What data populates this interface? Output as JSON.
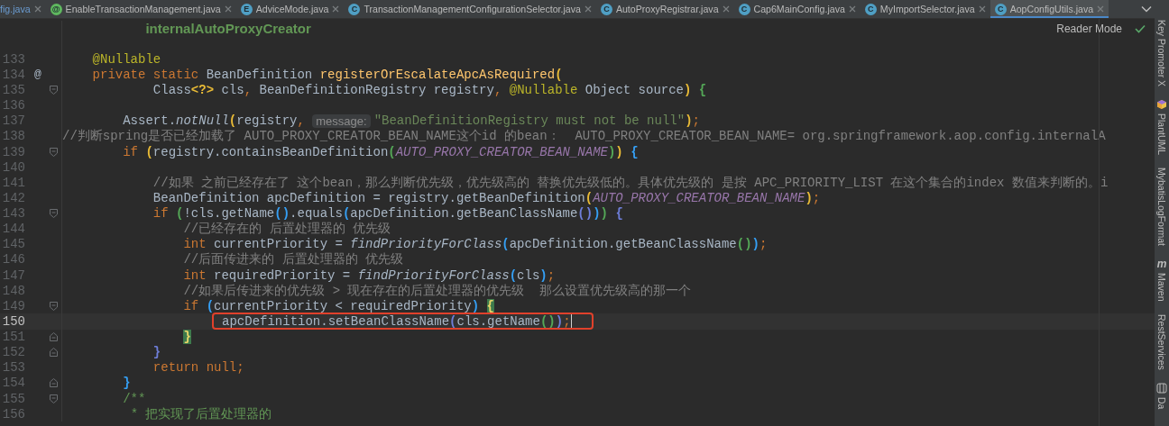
{
  "tabs": [
    {
      "label": "fig.java",
      "selected": false
    },
    {
      "label": "EnableTransactionManagement.java",
      "kind": "annotation",
      "icon_letter": "@",
      "selected": false
    },
    {
      "label": "AdviceMode.java",
      "kind": "enum",
      "icon_letter": "E",
      "selected": false
    },
    {
      "label": "TransactionManagementConfigurationSelector.java",
      "kind": "class",
      "icon_letter": "C",
      "selected": false
    },
    {
      "label": "AutoProxyRegistrar.java",
      "kind": "class",
      "icon_letter": "C",
      "selected": false
    },
    {
      "label": "Cap6MainConfig.java",
      "kind": "class",
      "icon_letter": "C",
      "selected": false
    },
    {
      "label": "MyImportSelector.java",
      "kind": "class",
      "icon_letter": "C",
      "selected": false
    },
    {
      "label": "AopConfigUtils.java",
      "kind": "class",
      "icon_letter": "C",
      "selected": true
    }
  ],
  "reader_mode": {
    "label": "Reader Mode"
  },
  "lines": [
    {
      "current": false,
      "tokens": [
        {
          "kind": "doc-bold",
          "text": "           internalAutoProxyCreator"
        }
      ]
    },
    {
      "current": false
    },
    {
      "number": "133",
      "current": false,
      "tokens": [
        {
          "kind": "annotation",
          "text": "    @Nullable"
        }
      ]
    },
    {
      "number": "134",
      "gutter": "@",
      "current": false,
      "tokens": [
        {
          "kind": "keyword",
          "text": "    private static "
        },
        {
          "kind": "plain",
          "text": "BeanDefinition "
        },
        {
          "kind": "decl",
          "text": "registerOrEscalateApcAsRequired"
        },
        {
          "kind": "bracket",
          "text": "(",
          "color": "#e8ba36"
        }
      ]
    },
    {
      "number": "135",
      "fold_open": true,
      "current": false,
      "tokens": [
        {
          "kind": "plain",
          "text": "            Class"
        },
        {
          "kind": "bracket",
          "text": "<?>",
          "color": "#e8ba36"
        },
        {
          "kind": "plain",
          "text": " cls"
        },
        {
          "kind": "keyword",
          "text": ", "
        },
        {
          "kind": "plain",
          "text": "BeanDefinitionRegistry registry"
        },
        {
          "kind": "keyword",
          "text": ", "
        },
        {
          "kind": "annotation",
          "text": "@Nullable"
        },
        {
          "kind": "plain",
          "text": " Object source"
        },
        {
          "kind": "bracket",
          "text": ") ",
          "color": "#e8ba36"
        },
        {
          "kind": "bracket",
          "text": "{",
          "color": "#54a857"
        }
      ]
    },
    {
      "number": "136",
      "current": false
    },
    {
      "number": "137",
      "current": false,
      "tokens": [
        {
          "kind": "plain",
          "text": "        Assert."
        },
        {
          "kind": "static-call",
          "text": "notNull"
        },
        {
          "kind": "bracket",
          "text": "(",
          "color": "#e8ba36"
        },
        {
          "kind": "plain",
          "text": "registry"
        },
        {
          "kind": "keyword",
          "text": ", "
        },
        {
          "kind": "hint",
          "text": "message:"
        },
        {
          "kind": "string",
          "text": "\"BeanDefinitionRegistry must not be null\""
        },
        {
          "kind": "bracket",
          "text": ")",
          "color": "#e8ba36"
        },
        {
          "kind": "keyword",
          "text": ";"
        }
      ]
    },
    {
      "number": "138",
      "current": false,
      "tokens": [
        {
          "kind": "comment",
          "text": "//判断spring是否已经加载了 AUTO_PROXY_CREATOR_BEAN_NAME这个id 的bean：  AUTO_PROXY_CREATOR_BEAN_NAME= org.springframework.aop.config.internalA"
        }
      ]
    },
    {
      "number": "139",
      "fold_open": true,
      "current": false,
      "tokens": [
        {
          "kind": "keyword",
          "text": "        if "
        },
        {
          "kind": "bracket",
          "text": "(",
          "color": "#e8ba36"
        },
        {
          "kind": "plain",
          "text": "registry.containsBeanDefinition"
        },
        {
          "kind": "bracket",
          "text": "(",
          "color": "#54a857"
        },
        {
          "kind": "constant",
          "text": "AUTO_PROXY_CREATOR_BEAN_NAME"
        },
        {
          "kind": "bracket",
          "text": ")",
          "color": "#54a857"
        },
        {
          "kind": "bracket",
          "text": ") ",
          "color": "#e8ba36"
        },
        {
          "kind": "bracket",
          "text": "{",
          "color": "#359ff4"
        }
      ]
    },
    {
      "number": "140",
      "current": false
    },
    {
      "number": "141",
      "current": false,
      "tokens": [
        {
          "kind": "comment",
          "text": "            //如果 之前已经存在了 这个bean，那么判断优先级，优先级高的 替换优先级低的。具体优先级的 是按 APC_PRIORITY_LIST 在这个集合的index 数值来判断的。i"
        }
      ]
    },
    {
      "number": "142",
      "current": false,
      "tokens": [
        {
          "kind": "plain",
          "text": "            BeanDefinition apcDefinition = registry.getBeanDefinition"
        },
        {
          "kind": "bracket",
          "text": "(",
          "color": "#e8ba36"
        },
        {
          "kind": "constant",
          "text": "AUTO_PROXY_CREATOR_BEAN_NAME"
        },
        {
          "kind": "bracket",
          "text": ")",
          "color": "#e8ba36"
        },
        {
          "kind": "keyword",
          "text": ";"
        }
      ]
    },
    {
      "number": "143",
      "fold_open": true,
      "current": false,
      "tokens": [
        {
          "kind": "keyword",
          "text": "            if "
        },
        {
          "kind": "bracket",
          "text": "(",
          "color": "#54a857"
        },
        {
          "kind": "plain",
          "text": "!cls.getName"
        },
        {
          "kind": "bracket",
          "text": "()",
          "color": "#359ff4"
        },
        {
          "kind": "plain",
          "text": ".equals"
        },
        {
          "kind": "bracket",
          "text": "(",
          "color": "#359ff4"
        },
        {
          "kind": "plain",
          "text": "apcDefinition.getBeanClassName"
        },
        {
          "kind": "bracket",
          "text": "()",
          "color": "#6e7ed9"
        },
        {
          "kind": "bracket",
          "text": ")",
          "color": "#359ff4"
        },
        {
          "kind": "bracket",
          "text": ") ",
          "color": "#54a857"
        },
        {
          "kind": "bracket",
          "text": "{",
          "color": "#6e7ed9"
        }
      ]
    },
    {
      "number": "144",
      "current": false,
      "tokens": [
        {
          "kind": "comment",
          "text": "                //已经存在的 后置处理器的 优先级"
        }
      ]
    },
    {
      "number": "145",
      "current": false,
      "tokens": [
        {
          "kind": "keyword",
          "text": "                int "
        },
        {
          "kind": "plain",
          "text": "currentPriority = "
        },
        {
          "kind": "static-call",
          "text": "findPriorityForClass"
        },
        {
          "kind": "bracket",
          "text": "(",
          "color": "#359ff4"
        },
        {
          "kind": "plain",
          "text": "apcDefinition.getBeanClassName"
        },
        {
          "kind": "bracket",
          "text": "()",
          "color": "#54a857"
        },
        {
          "kind": "bracket",
          "text": ")",
          "color": "#359ff4"
        },
        {
          "kind": "keyword",
          "text": ";"
        }
      ]
    },
    {
      "number": "146",
      "current": false,
      "tokens": [
        {
          "kind": "comment",
          "text": "                //后面传进来的 后置处理器的 优先级"
        }
      ]
    },
    {
      "number": "147",
      "current": false,
      "tokens": [
        {
          "kind": "keyword",
          "text": "                int "
        },
        {
          "kind": "plain",
          "text": "requiredPriority = "
        },
        {
          "kind": "static-call",
          "text": "findPriorityForClass"
        },
        {
          "kind": "bracket",
          "text": "(",
          "color": "#359ff4"
        },
        {
          "kind": "plain",
          "text": "cls"
        },
        {
          "kind": "bracket",
          "text": ")",
          "color": "#359ff4"
        },
        {
          "kind": "keyword",
          "text": ";"
        }
      ]
    },
    {
      "number": "148",
      "current": false,
      "tokens": [
        {
          "kind": "comment",
          "text": "                //如果后传进来的优先级 > 现在存在的后置处理器的优先级  那么设置优先级高的那一个"
        }
      ]
    },
    {
      "number": "149",
      "fold_open": true,
      "current": false,
      "tokens": [
        {
          "kind": "keyword",
          "text": "                if "
        },
        {
          "kind": "bracket",
          "text": "(",
          "color": "#359ff4"
        },
        {
          "kind": "plain",
          "text": "currentPriority < requiredPriority"
        },
        {
          "kind": "bracket",
          "text": ") ",
          "color": "#359ff4"
        },
        {
          "kind": "brace-match",
          "text": "{"
        }
      ]
    },
    {
      "number": "150",
      "current": true,
      "boxed_tokens": [
        {
          "kind": "plain",
          "text": "                    apcDefinition.setBeanClassName"
        },
        {
          "kind": "bracket",
          "text": "(",
          "color": "#6e7ed9"
        },
        {
          "kind": "plain",
          "text": "cls.getName"
        },
        {
          "kind": "bracket",
          "text": "()",
          "color": "#54a857"
        },
        {
          "kind": "bracket",
          "text": ")",
          "color": "#6e7ed9"
        },
        {
          "kind": "keyword",
          "text": ";"
        }
      ]
    },
    {
      "number": "151",
      "fold_close": true,
      "current": false,
      "tokens": [
        {
          "kind": "brace-match",
          "text": "                }"
        }
      ]
    },
    {
      "number": "152",
      "fold_close": true,
      "current": false,
      "tokens": [
        {
          "kind": "bracket",
          "text": "            }",
          "color": "#6e7ed9"
        }
      ]
    },
    {
      "number": "153",
      "current": false,
      "tokens": [
        {
          "kind": "keyword",
          "text": "            return null;"
        }
      ]
    },
    {
      "number": "154",
      "fold_close": true,
      "current": false,
      "tokens": [
        {
          "kind": "bracket",
          "text": "        }",
          "color": "#359ff4"
        }
      ]
    },
    {
      "number": "155",
      "fold_open": true,
      "current": false,
      "tokens": [
        {
          "kind": "doc",
          "text": "        /**"
        }
      ]
    },
    {
      "number": "156",
      "current": false,
      "tokens": [
        {
          "kind": "doc",
          "text": "         * 把实现了后置处理器的"
        }
      ]
    }
  ],
  "tool_windows": [
    {
      "label": "Key Promoter X"
    },
    {
      "label": "PlantUML",
      "kind": "plantuml"
    },
    {
      "label": "MybatisLogFormat"
    },
    {
      "label": "Maven",
      "kind": "letter",
      "icon_letter": "m"
    },
    {
      "label": "RestServices"
    },
    {
      "label": "Da",
      "kind": "database"
    }
  ]
}
